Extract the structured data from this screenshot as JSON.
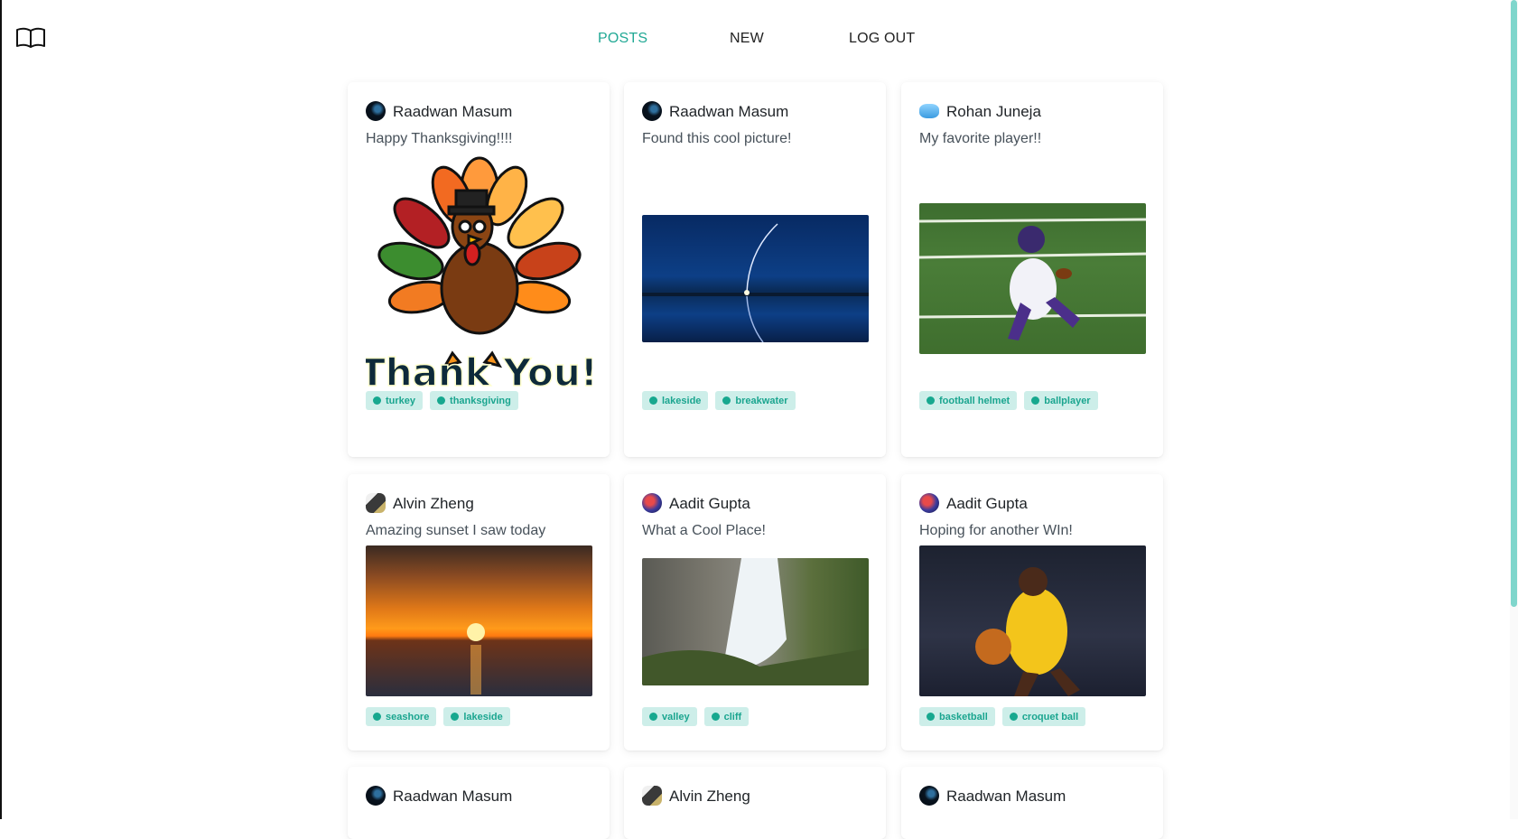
{
  "nav": {
    "posts_label": "POSTS",
    "new_label": "NEW",
    "logout_label": "LOG OUT"
  },
  "icons": {
    "logo": "open-book-icon"
  },
  "colors": {
    "accent": "#22a995",
    "tag_bg": "#cdeee9",
    "tag_text": "#1aa58f"
  },
  "posts": [
    {
      "author": "Raadwan Masum",
      "caption": "Happy Thanksgiving!!!!",
      "image": "thanksgiving turkey illustration",
      "image_text": "Thank You!",
      "tags": [
        "turkey",
        "thanksgiving"
      ]
    },
    {
      "author": "Raadwan Masum",
      "caption": "Found this cool picture!",
      "image": "night lake with rocket trail",
      "tags": [
        "lakeside",
        "breakwater"
      ]
    },
    {
      "author": "Rohan Juneja",
      "caption": "My favorite player!!",
      "image": "football player running",
      "tags": [
        "football helmet",
        "ballplayer"
      ]
    },
    {
      "author": "Alvin Zheng",
      "caption": "Amazing sunset I saw today",
      "image": "ocean sunset",
      "tags": [
        "seashore",
        "lakeside"
      ]
    },
    {
      "author": "Aadit Gupta",
      "caption": "What a Cool Place!",
      "image": "waterfall",
      "tags": [
        "valley",
        "cliff"
      ]
    },
    {
      "author": "Aadit Gupta",
      "caption": "Hoping for another WIn!",
      "image": "basketball player dribbling",
      "tags": [
        "basketball",
        "croquet ball"
      ]
    },
    {
      "author": "Raadwan Masum"
    },
    {
      "author": "Alvin Zheng"
    },
    {
      "author": "Raadwan Masum"
    }
  ]
}
